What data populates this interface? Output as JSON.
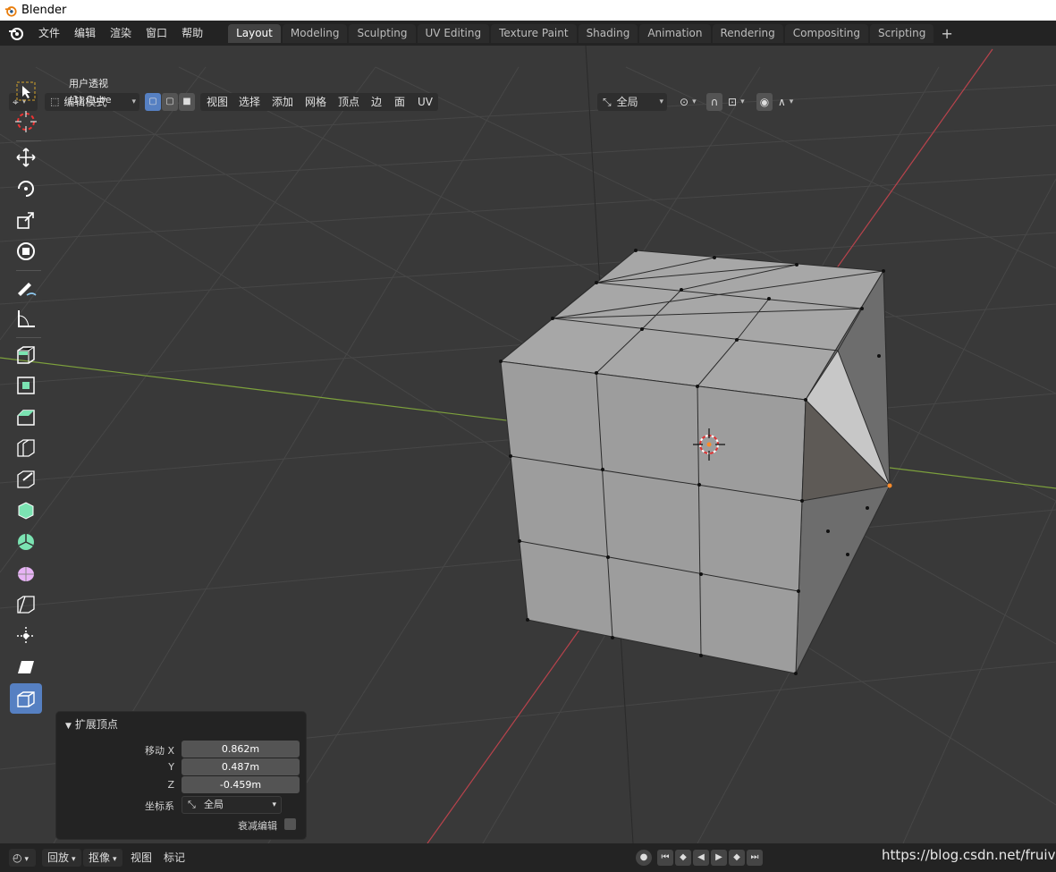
{
  "window": {
    "title": "Blender"
  },
  "menus": [
    "文件",
    "编辑",
    "渲染",
    "窗口",
    "帮助"
  ],
  "workspace_tabs": [
    "Layout",
    "Modeling",
    "Sculpting",
    "UV Editing",
    "Texture Paint",
    "Shading",
    "Animation",
    "Rendering",
    "Compositing",
    "Scripting"
  ],
  "active_tab": "Layout",
  "header": {
    "mode": "编辑模式",
    "menus": [
      "视图",
      "选择",
      "添加",
      "网格",
      "顶点",
      "边",
      "面",
      "UV"
    ],
    "orientation": "全局"
  },
  "viewport": {
    "view_name": "用户透视",
    "object_name": "(1) Cube"
  },
  "operator_panel": {
    "title": "扩展顶点",
    "fields": [
      {
        "label": "移动 X",
        "value": "0.862m"
      },
      {
        "label": "Y",
        "value": "0.487m"
      },
      {
        "label": "Z",
        "value": "-0.459m"
      }
    ],
    "orientation_label": "坐标系",
    "orientation_value": "全局",
    "proportional_label": "衰减编辑",
    "proportional_checked": false
  },
  "statusbar": {
    "playback": "回放",
    "keying": "抠像",
    "view": "视图",
    "marker": "标记"
  },
  "watermark": "https://blog.csdn.net/fruiva",
  "colors": {
    "accent": "#5680c2",
    "selected_vertex": "#ff8c2a",
    "x_axis": "#c2464f",
    "y_axis": "#8bb335"
  },
  "icons": [
    "blender-logo-icon",
    "select-box-icon",
    "cursor-icon",
    "move-icon",
    "rotate-icon",
    "scale-icon",
    "transform-icon",
    "annotate-icon",
    "measure-icon",
    "extrude-region-icon",
    "inset-faces-icon",
    "bevel-icon",
    "loop-cut-icon",
    "knife-icon",
    "poly-build-icon",
    "spin-icon",
    "smooth-icon",
    "edge-slide-icon",
    "shrink-fatten-icon",
    "shear-icon",
    "rip-region-icon"
  ]
}
